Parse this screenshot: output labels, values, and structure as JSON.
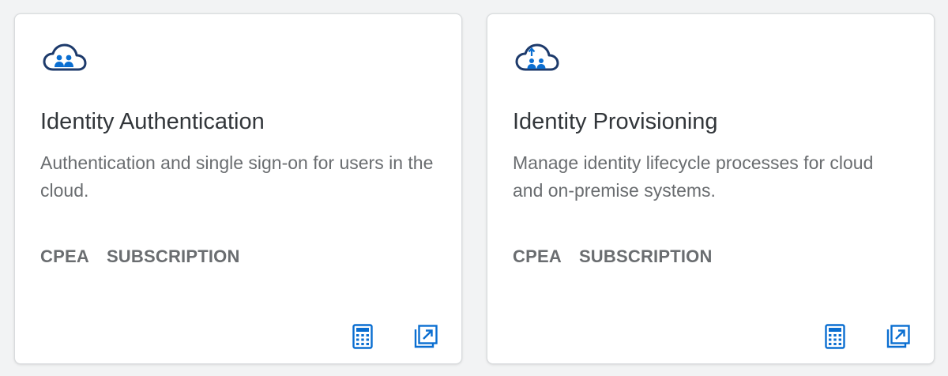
{
  "colors": {
    "accent": "#0a6ed1",
    "title": "#32363a",
    "muted": "#6a6d70",
    "icon_navy": "#1d3a6b"
  },
  "cards": [
    {
      "icon": "cloud-users-icon",
      "title": "Identity Authentication",
      "description": "Authentication and single sign-on for users in the cloud.",
      "tags": [
        "CPEA",
        "SUBSCRIPTION"
      ],
      "actions": [
        "calculator-icon",
        "open-external-icon"
      ]
    },
    {
      "icon": "cloud-users-upload-icon",
      "title": "Identity Provisioning",
      "description": "Manage identity lifecycle processes for cloud and on-premise systems.",
      "tags": [
        "CPEA",
        "SUBSCRIPTION"
      ],
      "actions": [
        "calculator-icon",
        "open-external-icon"
      ]
    }
  ]
}
